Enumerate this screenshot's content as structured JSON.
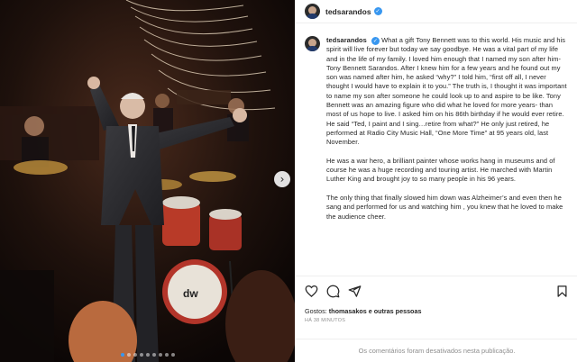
{
  "post": {
    "username": "tedsarandos",
    "verified_badge": "✓",
    "caption": [
      "What a gift Tony Bennett was to this world. His music and his spirit will live forever but today we say goodbye. He was a vital part of my life and in the life of my family. I loved him enough that I named my son after him- Tony Bennett Sarandos. After I knew him for a few years and he found out my son was named after him, he asked “why?” I told him, “first off all, I never thought I would have to explain it to you.” The truth is, I thought it was important to name my son after someone he could look up to and aspire to be like. Tony Bennett was an amazing figure who did what he loved for more years- than most of us hope to live. I asked him on his 86th birthday if he would ever retire. He said “Ted, I paint and I sing…retire from what?” He only just retired, he performed at Radio City Music Hall, “One More Time” at 95 years old, last November.",
      "He was a war hero, a brilliant painter whose works hang in museums and of course he was a huge recording and touring artist. He marched with Martin Luther King and brought joy to so many people in his 96 years.",
      "The only thing that finally slowed him down was Alzheimer’s and even then he sang and performed for us and watching him , you knew that he loved to make the audience cheer."
    ],
    "likes_prefix": "Gostos:",
    "likes_names": "thomasakos e outras pessoas",
    "timestamp": "HÁ 38 MINUTOS",
    "comments_disabled": "Os comentários foram desativados nesta publicação."
  },
  "carousel": {
    "next_icon": "›",
    "dot_count": 9,
    "active_index": 0
  },
  "icons": {
    "like": "heart-icon",
    "comment": "comment-icon",
    "share": "share-icon",
    "save": "bookmark-icon"
  },
  "colors": {
    "accent": "#3897f0",
    "text": "#262626",
    "muted": "#8e8e8e",
    "border": "#efefef"
  }
}
